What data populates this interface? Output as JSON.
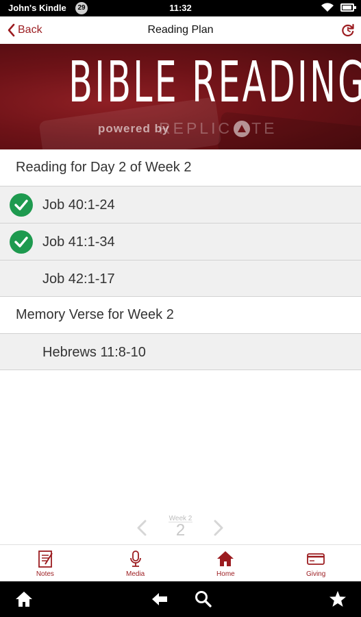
{
  "status_bar": {
    "device_name": "John's Kindle",
    "notification_count": "29",
    "time": "11:32"
  },
  "nav": {
    "back_label": "Back",
    "title": "Reading Plan"
  },
  "banner": {
    "title": "BIBLE READING",
    "powered_by": "powered by",
    "brand_left": "REPLIC",
    "brand_right": "TE"
  },
  "reading_section": {
    "header": "Reading for Day 2 of Week 2",
    "items": [
      {
        "label": "Job 40:1-24",
        "completed": true
      },
      {
        "label": "Job 41:1-34",
        "completed": true
      },
      {
        "label": "Job 42:1-17",
        "completed": false
      }
    ]
  },
  "memory_section": {
    "header": "Memory Verse for Week 2",
    "items": [
      {
        "label": "Hebrews 11:8-10"
      }
    ]
  },
  "pager": {
    "week_label": "Week 2",
    "week_number": "2"
  },
  "tab_bar": {
    "tabs": [
      {
        "label": "Notes",
        "icon": "notes-icon"
      },
      {
        "label": "Media",
        "icon": "microphone-icon"
      },
      {
        "label": "Home",
        "icon": "home-icon",
        "active": true
      },
      {
        "label": "Giving",
        "icon": "credit-card-icon"
      }
    ]
  },
  "colors": {
    "accent": "#9b1b1f",
    "check_green": "#1e9a4f",
    "row_bg": "#f0f0f0"
  }
}
